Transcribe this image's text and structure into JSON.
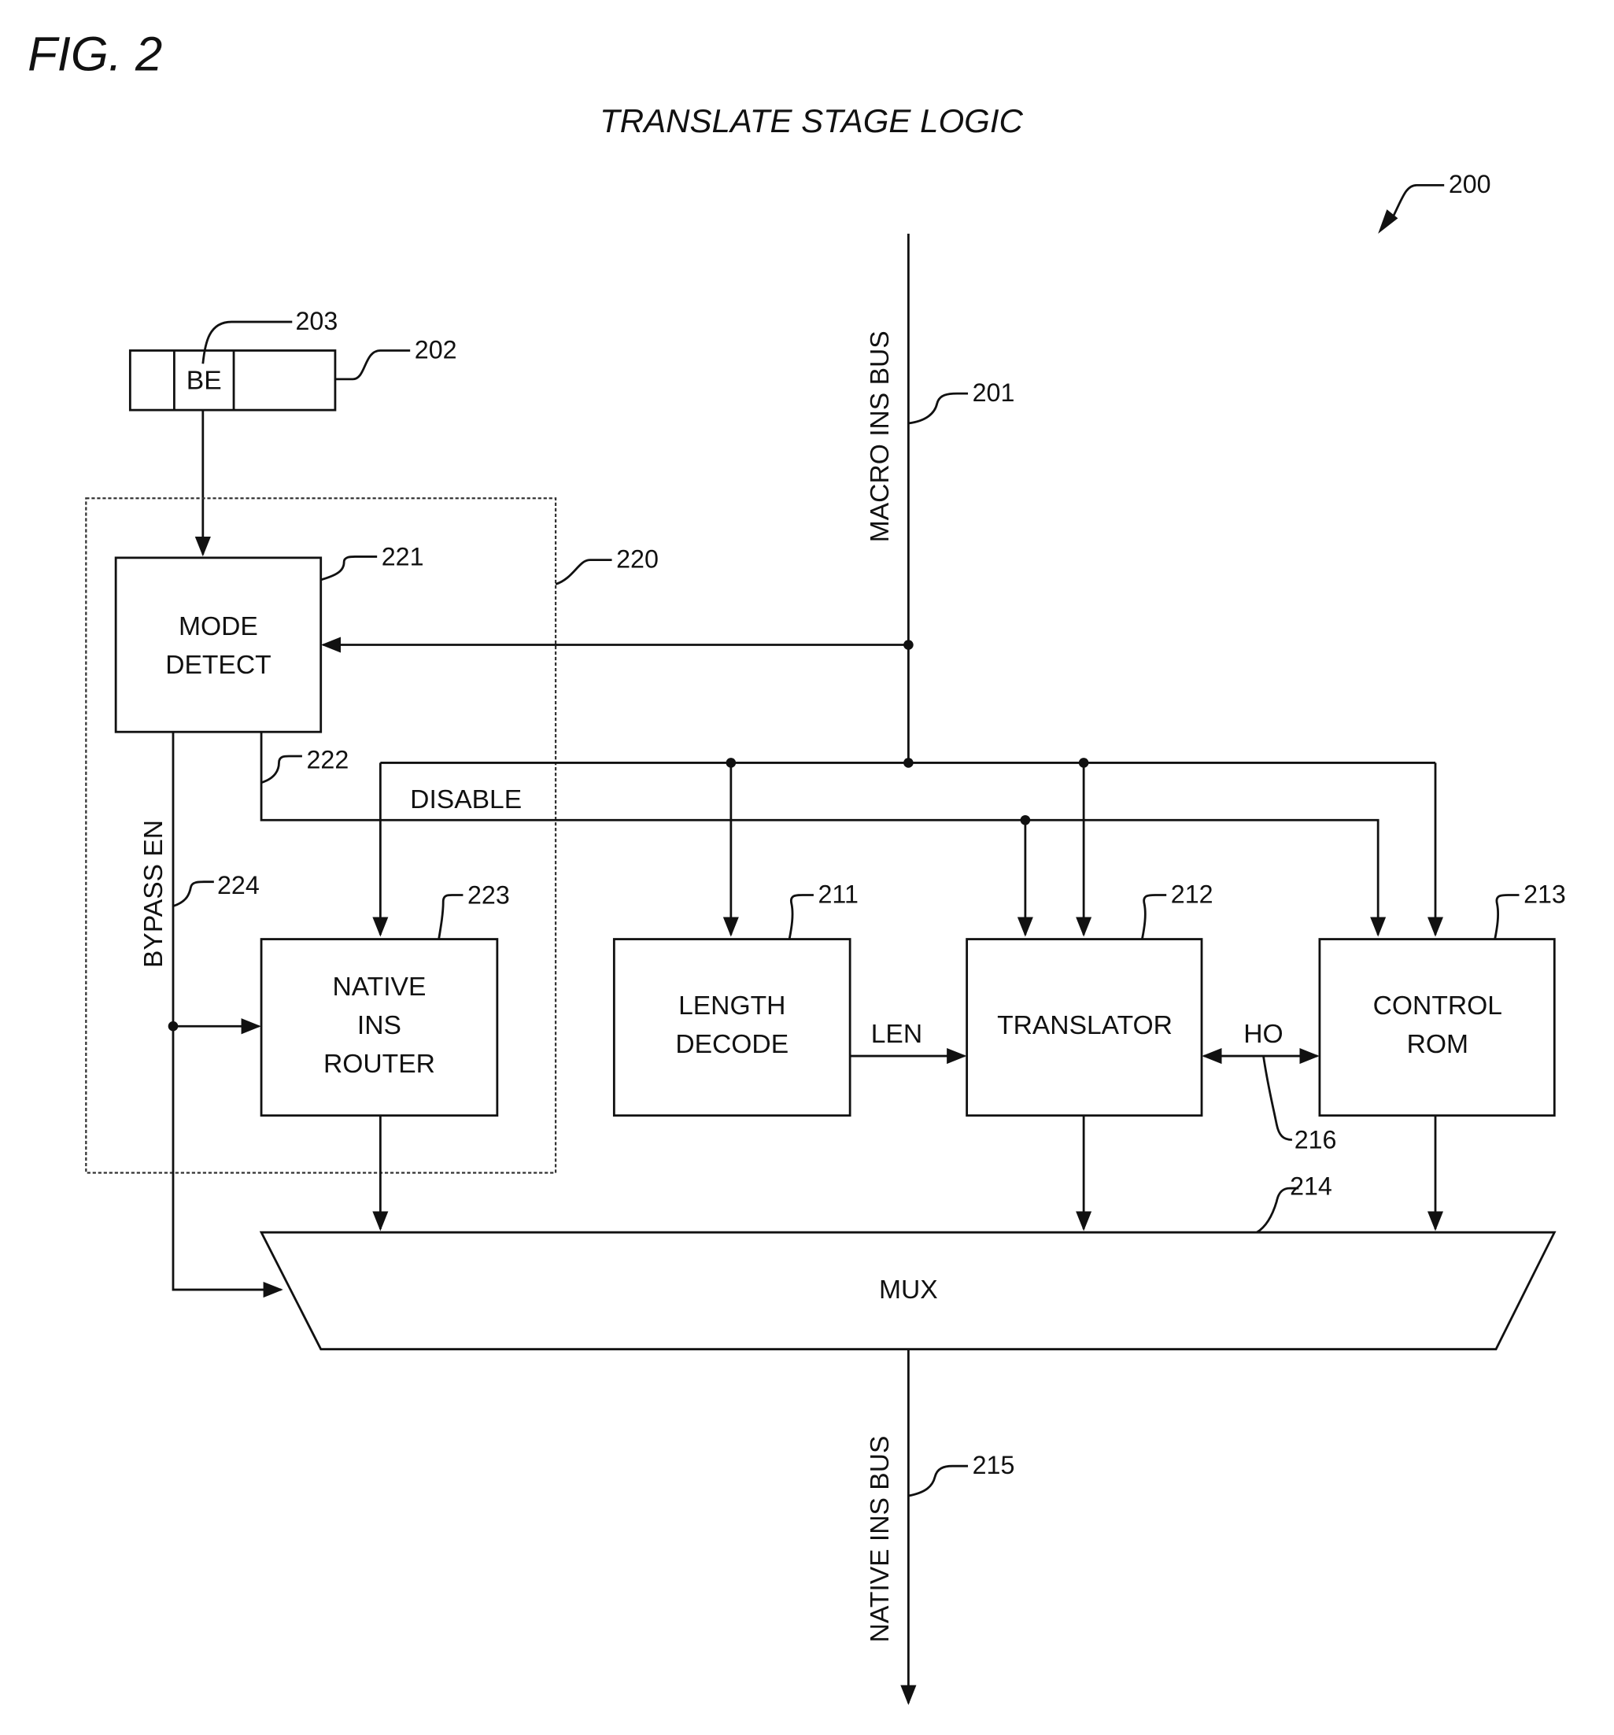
{
  "figure": {
    "label": "FIG. 2",
    "title": "TRANSLATE STAGE LOGIC",
    "ref": "200"
  },
  "register": {
    "ref": "202",
    "field_label": "BE",
    "field_ref": "203"
  },
  "buses": {
    "macro": {
      "label": "MACRO INS BUS",
      "ref": "201"
    },
    "native": {
      "label": "NATIVE INS BUS",
      "ref": "215"
    }
  },
  "bypass_logic": {
    "ref": "220"
  },
  "blocks": {
    "mode_detect": {
      "lines": [
        "MODE",
        "DETECT"
      ],
      "ref": "221"
    },
    "native_router": {
      "lines": [
        "NATIVE",
        "INS",
        "ROUTER"
      ],
      "ref": "223"
    },
    "length_decode": {
      "lines": [
        "LENGTH",
        "DECODE"
      ],
      "ref": "211"
    },
    "translator": {
      "lines": [
        "TRANSLATOR"
      ],
      "ref": "212"
    },
    "control_rom": {
      "lines": [
        "CONTROL",
        "ROM"
      ],
      "ref": "213"
    },
    "mux": {
      "label": "MUX",
      "ref": "214"
    }
  },
  "signals": {
    "disable": {
      "label": "DISABLE",
      "ref": "222"
    },
    "bypass_en": {
      "label": "BYPASS EN",
      "ref": "224"
    },
    "len": {
      "label": "LEN"
    },
    "ho": {
      "label": "HO",
      "ref": "216"
    }
  }
}
